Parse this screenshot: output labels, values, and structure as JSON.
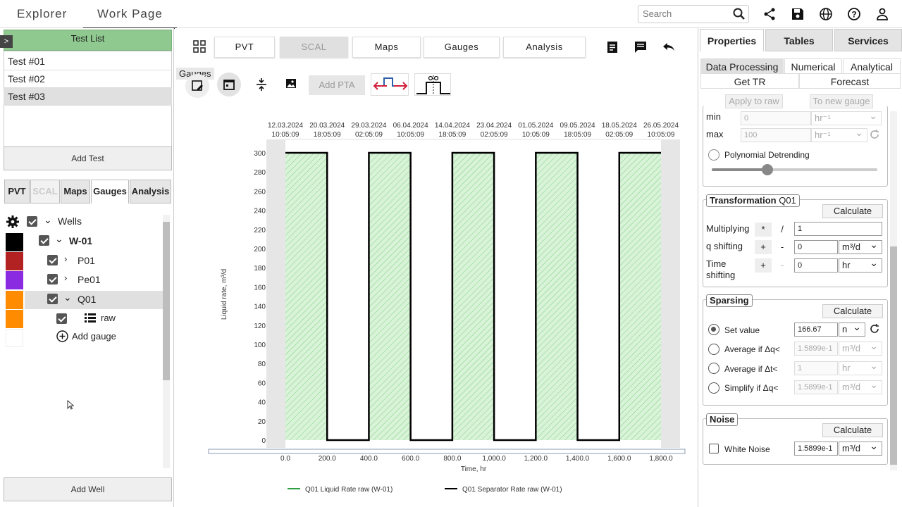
{
  "header": {
    "tabs": [
      "Explorer",
      "Work Page"
    ],
    "search_placeholder": "Search"
  },
  "test_list": {
    "title": "Test List",
    "tests": [
      "Test #01",
      "Test #02",
      "Test #03"
    ],
    "add_test_label": "Add Test",
    "add_well_label": "Add Well"
  },
  "left_tabs": [
    "PVT",
    "SCAL",
    "Maps",
    "Gauges",
    "Analysis"
  ],
  "tree": {
    "root": "Wells",
    "well": "W-01",
    "gauges": [
      "P01",
      "Pe01",
      "Q01"
    ],
    "sub": "raw",
    "add_gauge": "Add gauge",
    "colors": {
      "well": "#000000",
      "P01": "#b22222",
      "Pe01": "#8a2be2",
      "Q01": "#ff8c00"
    }
  },
  "center_tabs": [
    "PVT",
    "SCAL",
    "Maps",
    "Gauges",
    "Analysis"
  ],
  "toolbar": {
    "tooltip": "Gauges",
    "add_pta": "Add PTA"
  },
  "chart_data": {
    "type": "area",
    "top_dates": [
      [
        "12.03.2024",
        "10:05:09"
      ],
      [
        "20.03.2024",
        "18:05:09"
      ],
      [
        "29.03.2024",
        "02:05:09"
      ],
      [
        "06.04.2024",
        "10:05:09"
      ],
      [
        "14.04.2024",
        "18:05:09"
      ],
      [
        "23.04.2024",
        "02:05:09"
      ],
      [
        "01.05.2024",
        "10:05:09"
      ],
      [
        "09.05.2024",
        "18:05:09"
      ],
      [
        "18.05.2024",
        "02:05:09"
      ],
      [
        "26.05.2024",
        "10:05:09"
      ]
    ],
    "xlabel": "Time, hr",
    "ylabel": "Liquid rate, m³/d",
    "xlim": [
      0,
      1800
    ],
    "ylim": [
      0,
      300
    ],
    "x_ticks": [
      "0.0",
      "200.0",
      "400.0",
      "600.0",
      "800.0",
      "1,000.0",
      "1,200.0",
      "1,400.0",
      "1,600.0",
      "1,800.0"
    ],
    "x_tick_values": [
      0,
      200,
      400,
      600,
      800,
      1000,
      1200,
      1400,
      1600,
      1800
    ],
    "y_ticks": [
      0,
      20,
      40,
      60,
      80,
      100,
      120,
      140,
      160,
      180,
      200,
      220,
      240,
      260,
      280,
      300
    ],
    "series": [
      {
        "name": "Q01 Liquid Rate raw (W-01)",
        "color": "#2ea043",
        "intervals": [
          [
            0,
            200
          ],
          [
            400,
            600
          ],
          [
            800,
            1000
          ],
          [
            1200,
            1400
          ],
          [
            1600,
            1800
          ]
        ],
        "value": 300
      },
      {
        "name": "Q01 Separator Rate raw (W-01)",
        "color": "#000000",
        "x": [
          0,
          200,
          200,
          400,
          400,
          600,
          600,
          800,
          800,
          1000,
          1000,
          1200,
          1200,
          1400,
          1400,
          1600,
          1600,
          1800
        ],
        "y": [
          300,
          300,
          0,
          0,
          300,
          300,
          0,
          0,
          300,
          300,
          0,
          0,
          300,
          300,
          0,
          0,
          300,
          300
        ]
      }
    ]
  },
  "right": {
    "tabs": [
      "Properties",
      "Tables",
      "Services"
    ],
    "subtabs": [
      "Data Processing",
      "Numerical",
      "Analytical",
      "Get TR",
      "Forecast"
    ],
    "apply_raw": "Apply to raw",
    "new_gauge": "To new gauge",
    "min_label": "min",
    "min_value": "0",
    "min_unit": "hr⁻¹",
    "max_label": "max",
    "max_value": "100",
    "max_unit": "hr⁻¹",
    "poly_label": "Polynomial Detrending",
    "transformation": {
      "title": "Transformation",
      "title_suffix": "Q01",
      "calc": "Calculate",
      "mult_label": "Multiplying",
      "mult_ops": [
        "*",
        "/"
      ],
      "mult_value": "1",
      "q_label": "q shifting",
      "q_ops": [
        "+",
        "-"
      ],
      "q_value": "0",
      "q_unit": "m³/d",
      "t_label1": "Time",
      "t_label2": "shifting",
      "t_ops": [
        "+",
        "-"
      ],
      "t_value": "0",
      "t_unit": "hr"
    },
    "sparsing": {
      "title": "Sparsing",
      "calc": "Calculate",
      "options": [
        {
          "label": "Set value",
          "value": "166.67",
          "unit": "n"
        },
        {
          "label": "Average if Δq<",
          "value": "1.5899e-1",
          "unit": "m³/d"
        },
        {
          "label": "Average if Δt<",
          "value": "1",
          "unit": "hr"
        },
        {
          "label": "Simplify if Δq<",
          "value": "1.5899e-1",
          "unit": "m³/d"
        }
      ]
    },
    "noise": {
      "title": "Noise",
      "calc": "Calculate",
      "label": "White Noise",
      "value": "1.5899e-1",
      "unit": "m³/d"
    }
  }
}
